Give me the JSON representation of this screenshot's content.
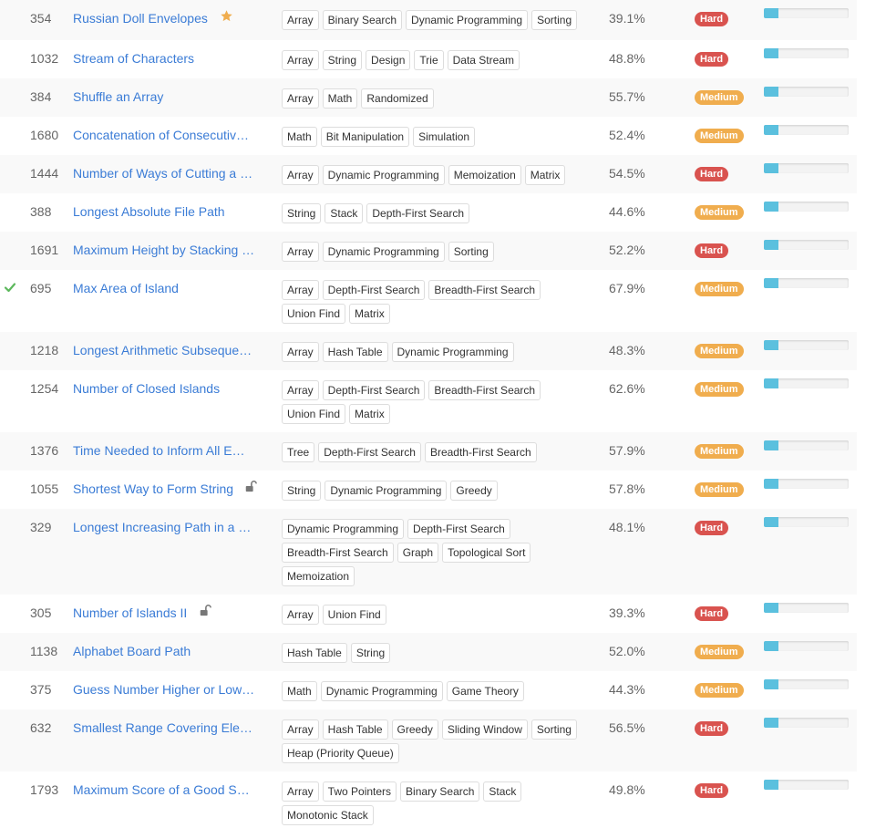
{
  "problems": [
    {
      "id": "354",
      "title": "Russian Doll Envelopes",
      "title_icon": "star-icon",
      "tags": [
        "Array",
        "Binary Search",
        "Dynamic Programming",
        "Sorting"
      ],
      "acceptance": "39.1%",
      "difficulty": "Hard",
      "solved": false,
      "frequency": 0.17
    },
    {
      "id": "1032",
      "title": "Stream of Characters",
      "title_icon": "",
      "tags": [
        "Array",
        "String",
        "Design",
        "Trie",
        "Data Stream"
      ],
      "acceptance": "48.8%",
      "difficulty": "Hard",
      "solved": false,
      "frequency": 0.17
    },
    {
      "id": "384",
      "title": "Shuffle an Array",
      "title_icon": "",
      "tags": [
        "Array",
        "Math",
        "Randomized"
      ],
      "acceptance": "55.7%",
      "difficulty": "Medium",
      "solved": false,
      "frequency": 0.17
    },
    {
      "id": "1680",
      "title": "Concatenation of Consecutiv…",
      "title_icon": "",
      "tags": [
        "Math",
        "Bit Manipulation",
        "Simulation"
      ],
      "acceptance": "52.4%",
      "difficulty": "Medium",
      "solved": false,
      "frequency": 0.17
    },
    {
      "id": "1444",
      "title": "Number of Ways of Cutting a …",
      "title_icon": "",
      "tags": [
        "Array",
        "Dynamic Programming",
        "Memoization",
        "Matrix"
      ],
      "acceptance": "54.5%",
      "difficulty": "Hard",
      "solved": false,
      "frequency": 0.17
    },
    {
      "id": "388",
      "title": "Longest Absolute File Path",
      "title_icon": "",
      "tags": [
        "String",
        "Stack",
        "Depth-First Search"
      ],
      "acceptance": "44.6%",
      "difficulty": "Medium",
      "solved": false,
      "frequency": 0.17
    },
    {
      "id": "1691",
      "title": "Maximum Height by Stacking …",
      "title_icon": "",
      "tags": [
        "Array",
        "Dynamic Programming",
        "Sorting"
      ],
      "acceptance": "52.2%",
      "difficulty": "Hard",
      "solved": false,
      "frequency": 0.17
    },
    {
      "id": "695",
      "title": "Max Area of Island",
      "title_icon": "",
      "tags": [
        "Array",
        "Depth-First Search",
        "Breadth-First Search",
        "Union Find",
        "Matrix"
      ],
      "acceptance": "67.9%",
      "difficulty": "Medium",
      "solved": true,
      "frequency": 0.17
    },
    {
      "id": "1218",
      "title": "Longest Arithmetic Subseque…",
      "title_icon": "",
      "tags": [
        "Array",
        "Hash Table",
        "Dynamic Programming"
      ],
      "acceptance": "48.3%",
      "difficulty": "Medium",
      "solved": false,
      "frequency": 0.17
    },
    {
      "id": "1254",
      "title": "Number of Closed Islands",
      "title_icon": "",
      "tags": [
        "Array",
        "Depth-First Search",
        "Breadth-First Search",
        "Union Find",
        "Matrix"
      ],
      "acceptance": "62.6%",
      "difficulty": "Medium",
      "solved": false,
      "frequency": 0.17
    },
    {
      "id": "1376",
      "title": "Time Needed to Inform All E…",
      "title_icon": "",
      "tags": [
        "Tree",
        "Depth-First Search",
        "Breadth-First Search"
      ],
      "acceptance": "57.9%",
      "difficulty": "Medium",
      "solved": false,
      "frequency": 0.17
    },
    {
      "id": "1055",
      "title": "Shortest Way to Form String",
      "title_icon": "lock-icon",
      "tags": [
        "String",
        "Dynamic Programming",
        "Greedy"
      ],
      "acceptance": "57.8%",
      "difficulty": "Medium",
      "solved": false,
      "frequency": 0.17
    },
    {
      "id": "329",
      "title": "Longest Increasing Path in a …",
      "title_icon": "",
      "tags": [
        "Dynamic Programming",
        "Depth-First Search",
        "Breadth-First Search",
        "Graph",
        "Topological Sort",
        "Memoization"
      ],
      "acceptance": "48.1%",
      "difficulty": "Hard",
      "solved": false,
      "frequency": 0.17
    },
    {
      "id": "305",
      "title": "Number of Islands II",
      "title_icon": "lock-icon",
      "tags": [
        "Array",
        "Union Find"
      ],
      "acceptance": "39.3%",
      "difficulty": "Hard",
      "solved": false,
      "frequency": 0.17
    },
    {
      "id": "1138",
      "title": "Alphabet Board Path",
      "title_icon": "",
      "tags": [
        "Hash Table",
        "String"
      ],
      "acceptance": "52.0%",
      "difficulty": "Medium",
      "solved": false,
      "frequency": 0.17
    },
    {
      "id": "375",
      "title": "Guess Number Higher or Low…",
      "title_icon": "",
      "tags": [
        "Math",
        "Dynamic Programming",
        "Game Theory"
      ],
      "acceptance": "44.3%",
      "difficulty": "Medium",
      "solved": false,
      "frequency": 0.17
    },
    {
      "id": "632",
      "title": "Smallest Range Covering Ele…",
      "title_icon": "",
      "tags": [
        "Array",
        "Hash Table",
        "Greedy",
        "Sliding Window",
        "Sorting",
        "Heap (Priority Queue)"
      ],
      "acceptance": "56.5%",
      "difficulty": "Hard",
      "solved": false,
      "frequency": 0.17
    },
    {
      "id": "1793",
      "title": "Maximum Score of a Good S…",
      "title_icon": "",
      "tags": [
        "Array",
        "Two Pointers",
        "Binary Search",
        "Stack",
        "Monotonic Stack"
      ],
      "acceptance": "49.8%",
      "difficulty": "Hard",
      "solved": false,
      "frequency": 0.17
    }
  ],
  "colors": {
    "link": "#3b7cd6",
    "hard": "#d9534f",
    "medium": "#f0ad4e",
    "solved_check": "#5cb85c",
    "frequency_fill": "#5bc0de",
    "star": "#f0ad4e"
  }
}
